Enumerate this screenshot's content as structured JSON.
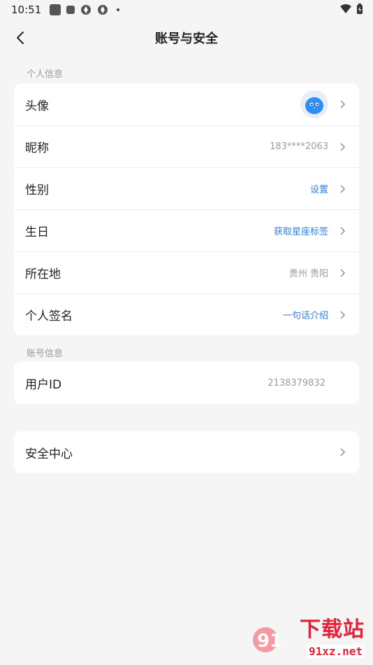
{
  "status_bar": {
    "time": "10:51"
  },
  "nav": {
    "title": "账号与安全"
  },
  "sections": {
    "personal": "个人信息",
    "account": "账号信息"
  },
  "personal_rows": [
    {
      "label": "头像",
      "value": ""
    },
    {
      "label": "昵称",
      "value": "183****2063"
    },
    {
      "label": "性别",
      "value": "设置"
    },
    {
      "label": "生日",
      "value": "获取星座标签"
    },
    {
      "label": "所在地",
      "value": "贵州 贵阳"
    },
    {
      "label": "个人签名",
      "value": "一句话介绍"
    }
  ],
  "account_rows": [
    {
      "label": "用户ID",
      "value": "2138379832"
    }
  ],
  "security_rows": [
    {
      "label": "安全中心"
    }
  ],
  "watermark": {
    "brand": "下载站",
    "url": "91xz.net",
    "logo_mark": "91"
  },
  "colors": {
    "accent": "#2f7fe0",
    "muted": "#9b9b9b",
    "bg": "#f5f5f5",
    "watermark": "#e3233a"
  }
}
